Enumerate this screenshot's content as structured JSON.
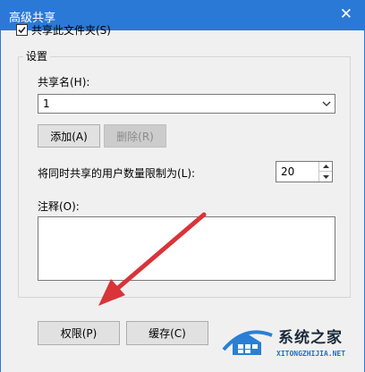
{
  "window": {
    "title": "高级共享",
    "close_glyph": "✕"
  },
  "share_checkbox": {
    "label": "共享此文件夹(S)",
    "checked": true
  },
  "settings_group": {
    "legend": "设置",
    "share_name_label": "共享名(H):",
    "share_name_value": "1",
    "add_button": "添加(A)",
    "remove_button": "删除(R)",
    "user_limit_label": "将同时共享的用户数量限制为(L):",
    "user_limit_value": "20",
    "comment_label": "注释(O):",
    "comment_value": ""
  },
  "buttons": {
    "permissions": "权限(P)",
    "caching": "缓存(C)"
  },
  "watermark": {
    "name": "系统之家",
    "url": "XITONGZHIJIA.NET"
  },
  "colors": {
    "titlebar": "#2b79d7",
    "annotation_arrow": "#d8343a"
  }
}
